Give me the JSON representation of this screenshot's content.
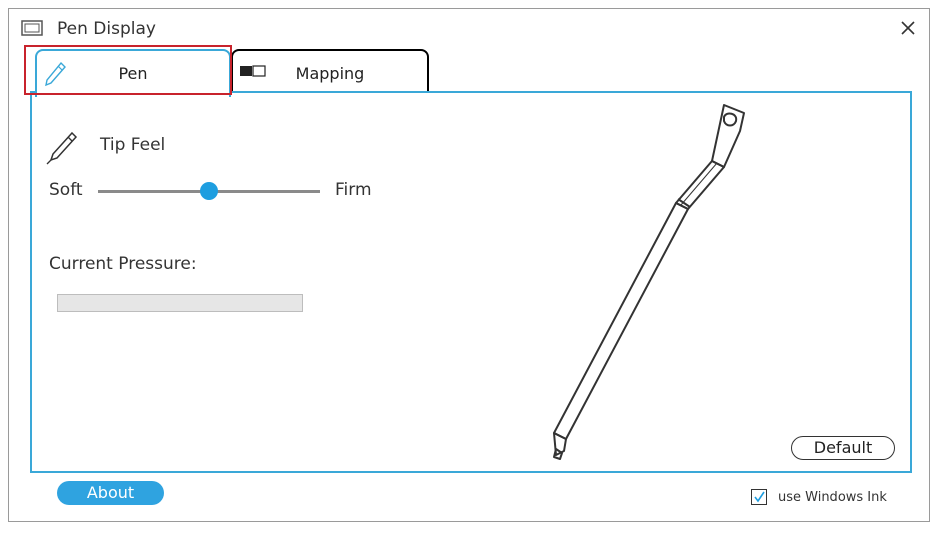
{
  "window": {
    "title": "Pen Display"
  },
  "tabs": [
    {
      "label": "Pen",
      "selected": true,
      "icon": "pen-icon"
    },
    {
      "label": "Mapping",
      "selected": false,
      "icon": "display-mapping-icon"
    }
  ],
  "tip_feel": {
    "label": "Tip Feel",
    "min_label": "Soft",
    "max_label": "Firm",
    "slider_value_fraction": 0.5
  },
  "pressure": {
    "label": "Current Pressure:",
    "value_fraction": 0
  },
  "buttons": {
    "default_label": "Default",
    "about_label": "About"
  },
  "windows_ink": {
    "label": "use Windows Ink",
    "checked": true
  },
  "colors": {
    "accent": "#1e9ee0",
    "panel_border": "#3aa8d8",
    "highlight": "#c8232c"
  }
}
